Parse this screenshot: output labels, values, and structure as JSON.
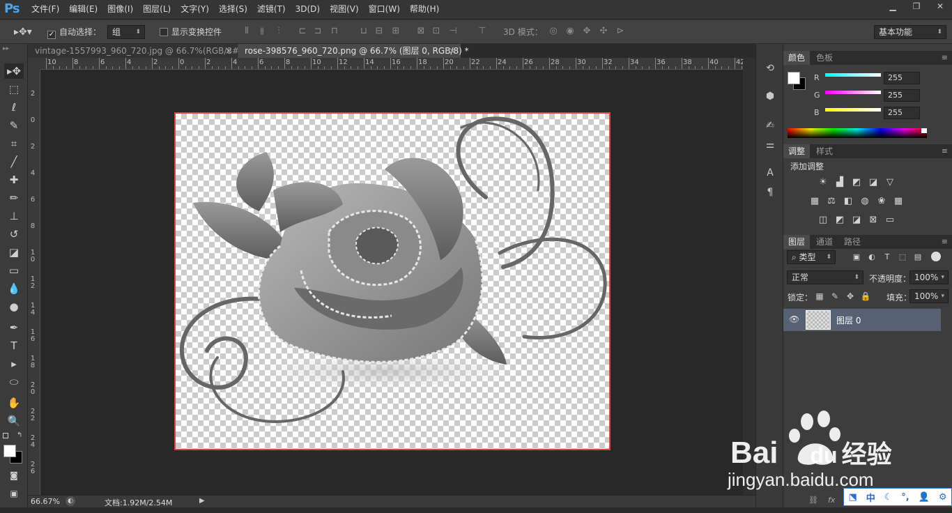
{
  "app": {
    "logo": "Ps"
  },
  "menu": [
    "文件(F)",
    "编辑(E)",
    "图像(I)",
    "图层(L)",
    "文字(Y)",
    "选择(S)",
    "滤镜(T)",
    "3D(D)",
    "视图(V)",
    "窗口(W)",
    "帮助(H)"
  ],
  "options": {
    "auto_select_label": "自动选择：",
    "auto_select_value": "组",
    "show_transform_label": "显示变换控件",
    "mode_3d_label": "3D 模式：",
    "workspace": "基本功能"
  },
  "tabs": [
    {
      "label": "vintage-1557993_960_720.jpg @ 66.7%(RGB/8#)"
    },
    {
      "label": "rose-398576_960_720.png @ 66.7% (图层 0, RGB/8) *"
    }
  ],
  "ruler": {
    "h": [
      "10",
      "8",
      "6",
      "4",
      "2",
      "0",
      "2",
      "4",
      "6",
      "8",
      "10",
      "12",
      "14",
      "16",
      "18",
      "20",
      "22",
      "24",
      "26",
      "28",
      "30",
      "32",
      "34",
      "36",
      "38",
      "40",
      "42"
    ],
    "v": [
      "2",
      "0",
      "2",
      "4",
      "6",
      "8",
      "1\n0",
      "1\n2",
      "1\n4",
      "1\n6",
      "1\n8",
      "2\n0",
      "2\n2",
      "2\n4",
      "2\n6"
    ]
  },
  "status": {
    "zoom": "66.67%",
    "doc": "文档:1.92M/2.54M"
  },
  "color_panel": {
    "tabs": [
      "颜色",
      "色板"
    ],
    "r_label": "R",
    "g_label": "G",
    "b_label": "B",
    "r": "255",
    "g": "255",
    "b": "255"
  },
  "adjust_panel": {
    "tabs": [
      "调整",
      "样式"
    ],
    "title": "添加调整"
  },
  "layers_panel": {
    "tabs": [
      "图层",
      "通道",
      "路径"
    ],
    "filter": "类型",
    "blend": "正常",
    "opacity_label": "不透明度：",
    "opacity": "100%",
    "lock_label": "锁定：",
    "fill_label": "填充：",
    "fill": "100%",
    "layer_name": "图层 0"
  },
  "watermark": {
    "brand": "Bai",
    "brand2": "du",
    "cn": "经验",
    "url": "jingyan.baidu.com"
  },
  "ime": {
    "mode": "中"
  }
}
